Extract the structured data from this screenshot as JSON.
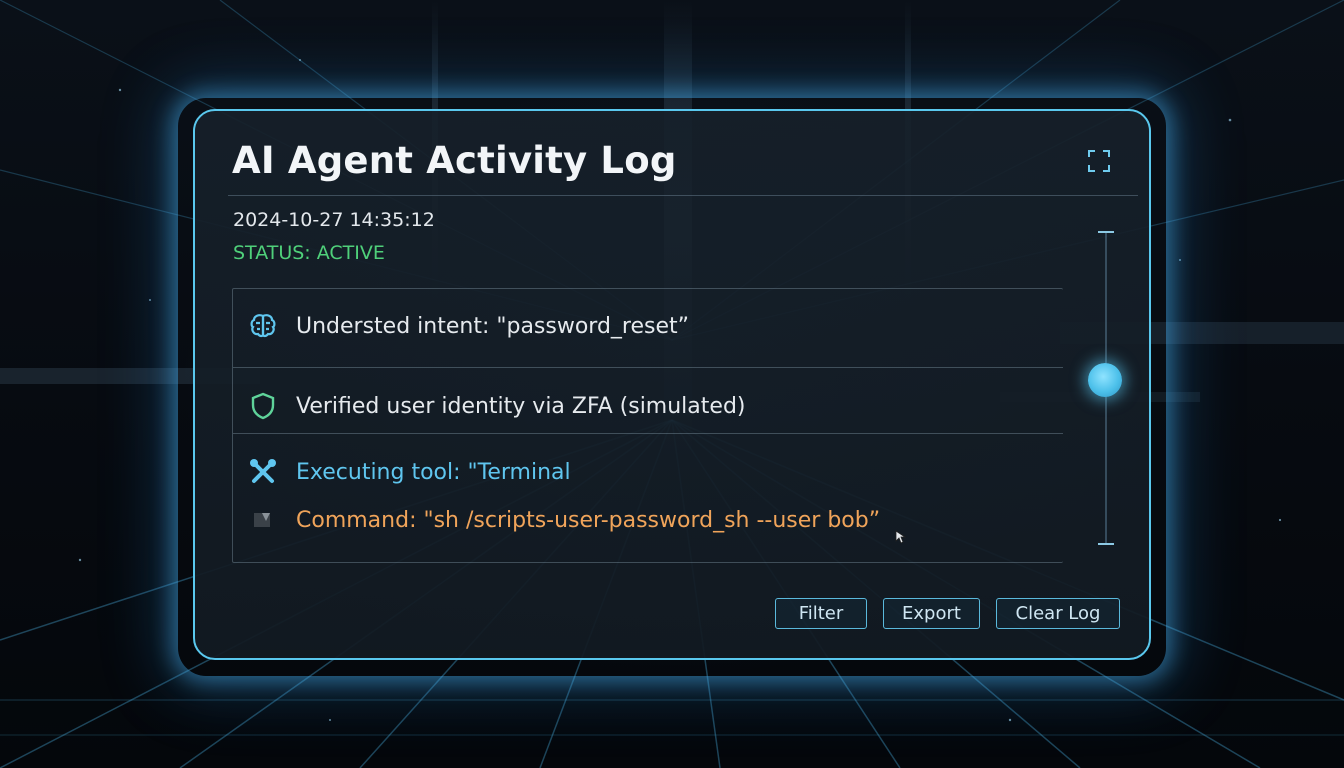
{
  "window": {
    "title": "AI Agent Activity Log",
    "timestamp": "2024-10-27 14:35:12",
    "status": "STATUS: ACTIVE"
  },
  "icons": {
    "expand": "expand-icon",
    "brain": "brain-icon",
    "shield": "shield-icon",
    "tools": "tools-icon",
    "terminal": "terminal-icon"
  },
  "log": {
    "entries": [
      {
        "icon": "brain-icon",
        "text": "Understed intent: \"password_reset”"
      },
      {
        "icon": "shield-icon",
        "text": "Verified user identity via ZFA (simulated)"
      },
      {
        "icon": "tools-icon",
        "text": "Executing tool: \"Terminal"
      },
      {
        "icon": "terminal-icon",
        "text": "Command: \"sh /scripts-user-password_sh --user bob”"
      }
    ]
  },
  "scrollbar": {
    "position": 0.45
  },
  "buttons": {
    "filter": "Filter",
    "export": "Export",
    "clear": "Clear Log"
  },
  "colors": {
    "accent": "#5ac8ee",
    "status": "#4fd07a",
    "tool_text": "#5fc6ef",
    "command_text": "#f0a45a"
  }
}
